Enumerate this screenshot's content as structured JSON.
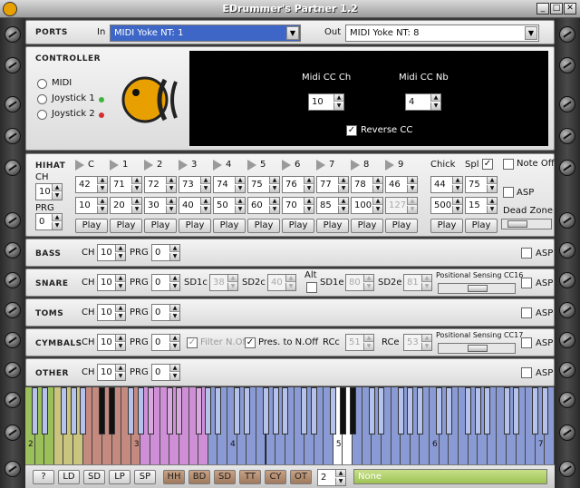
{
  "window": {
    "title": "EDrummer's Partner 1.2",
    "minimize": "_",
    "restore": "□",
    "close": "✕"
  },
  "ports": {
    "label": "PORTS",
    "in_label": "In",
    "in_value": "MIDI Yoke NT:  1",
    "out_label": "Out",
    "out_value": "MIDI Yoke NT:  8"
  },
  "controller": {
    "label": "CONTROLLER",
    "options": [
      "MIDI",
      "Joystick 1",
      "Joystick 2"
    ],
    "midi_cc_ch_label": "Midi CC Ch",
    "midi_cc_ch": "10",
    "midi_cc_nb_label": "Midi CC Nb",
    "midi_cc_nb": "4",
    "reverse_cc_label": "Reverse CC",
    "reverse_cc": true
  },
  "hihat": {
    "label": "HIHAT",
    "ch_label": "CH",
    "ch": "10",
    "prg_label": "PRG",
    "prg": "0",
    "zones": [
      "C",
      "1",
      "2",
      "3",
      "4",
      "5",
      "6",
      "7",
      "8",
      "9"
    ],
    "top_values": [
      "42",
      "71",
      "72",
      "73",
      "74",
      "75",
      "76",
      "77",
      "78",
      "46"
    ],
    "bottom_values": [
      "10",
      "20",
      "30",
      "40",
      "50",
      "60",
      "70",
      "85",
      "100",
      "127"
    ],
    "chick_label": "Chick",
    "chick_top": "44",
    "chick_bottom": "500",
    "spl_label": "Spl",
    "spl_checked": true,
    "spl_top": "75",
    "spl_bottom": "15",
    "note_off_label": "Note Off",
    "asp_label": "ASP",
    "dead_zone_label": "Dead Zone",
    "play_label": "Play"
  },
  "bass": {
    "label": "BASS",
    "ch_label": "CH",
    "ch": "10",
    "prg_label": "PRG",
    "prg": "0",
    "asp_label": "ASP"
  },
  "snare": {
    "label": "SNARE",
    "ch_label": "CH",
    "ch": "10",
    "prg_label": "PRG",
    "prg": "0",
    "sd1c_label": "SD1c",
    "sd1c": "38",
    "sd2c_label": "SD2c",
    "sd2c": "40",
    "alt_label": "Alt",
    "sd1e_label": "SD1e",
    "sd1e": "80",
    "sd2e_label": "SD2e",
    "sd2e": "81",
    "pos_label": "Positional Sensing CC16",
    "asp_label": "ASP"
  },
  "toms": {
    "label": "TOMS",
    "ch_label": "CH",
    "ch": "10",
    "prg_label": "PRG",
    "prg": "0",
    "asp_label": "ASP"
  },
  "cymbals": {
    "label": "CYMBALS",
    "ch_label": "CH",
    "ch": "10",
    "prg_label": "PRG",
    "prg": "0",
    "filter_label": "Filter N.Off",
    "pres_label": "Pres. to N.Off",
    "rcc_label": "RCc",
    "rcc": "51",
    "rce_label": "RCe",
    "rce": "53",
    "pos_label": "Positional Sensing CC17",
    "asp_label": "ASP"
  },
  "other": {
    "label": "OTHER",
    "ch_label": "CH",
    "ch": "10",
    "prg_label": "PRG",
    "prg": "0",
    "asp_label": "ASP"
  },
  "keyboard": {
    "octave_labels": [
      "2",
      "3",
      "4",
      "5",
      "6",
      "7"
    ]
  },
  "bottom": {
    "buttons": [
      "?",
      "LD",
      "SD",
      "LP",
      "SP"
    ],
    "groups": [
      "HH",
      "BD",
      "SD",
      "TT",
      "CY",
      "OT"
    ],
    "octave": "2",
    "status": "None"
  },
  "colors": {
    "accent": "#3d66c7",
    "logo": "#e8a000",
    "display_bg": "#000000"
  }
}
